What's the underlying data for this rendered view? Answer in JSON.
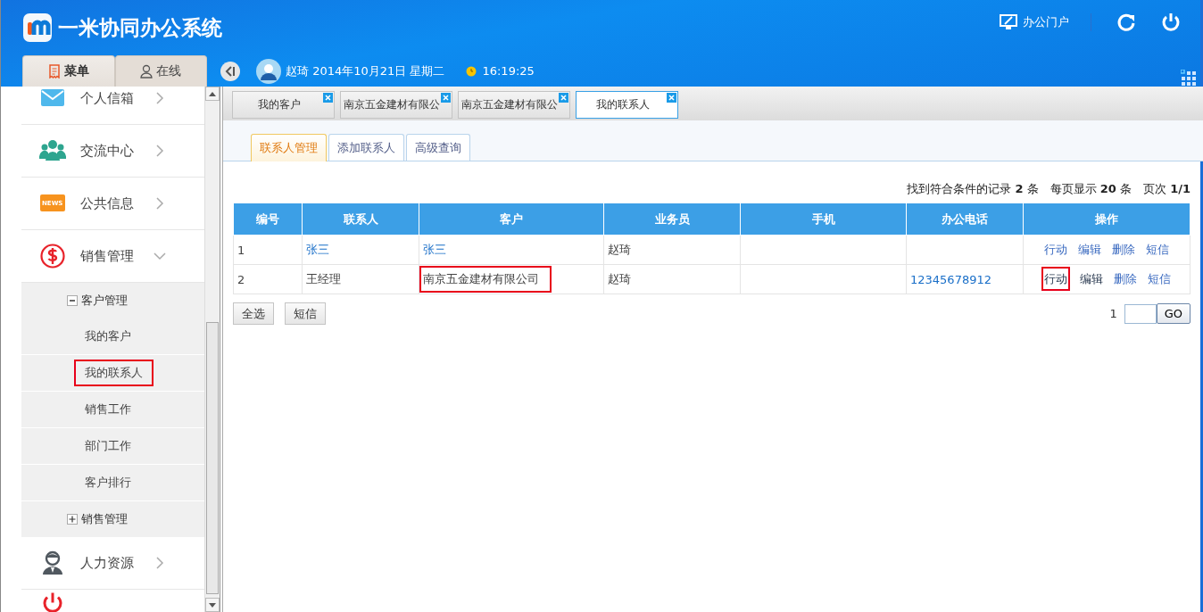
{
  "header": {
    "title": "一米协同办公系统",
    "portal_label": "办公门户"
  },
  "user_bar": {
    "user": "赵琦",
    "date": "2014年10月21日 星期二",
    "time": "16:19:25"
  },
  "sidebar": {
    "tabs": [
      {
        "label": "菜单",
        "kind": "receipt",
        "selected": true
      },
      {
        "label": "在线",
        "kind": "person",
        "selected": false
      }
    ],
    "items": [
      {
        "label": "个人信箱",
        "kind": "mail",
        "expanded": false
      },
      {
        "label": "交流中心",
        "kind": "people",
        "expanded": false
      },
      {
        "label": "公共信息",
        "kind": "news",
        "icon_text": "NEWS",
        "expanded": false
      },
      {
        "label": "销售管理",
        "kind": "dollar",
        "expanded": true,
        "children": [
          {
            "label": "客户管理",
            "expanded": true,
            "children": [
              {
                "label": "我的客户",
                "highlighted": false
              },
              {
                "label": "我的联系人",
                "highlighted": true
              },
              {
                "label": "销售工作",
                "highlighted": false
              },
              {
                "label": "部门工作",
                "highlighted": false
              },
              {
                "label": "客户排行",
                "highlighted": false
              }
            ]
          },
          {
            "label": "销售管理",
            "expanded": false
          }
        ]
      },
      {
        "label": "人力资源",
        "kind": "worker",
        "expanded": false
      },
      {
        "kind": "power"
      }
    ]
  },
  "page_tabs": [
    {
      "label": "我的客户",
      "selected": false
    },
    {
      "label": "南京五金建材有限公",
      "selected": false
    },
    {
      "label": "南京五金建材有限公",
      "selected": false
    },
    {
      "label": "我的联系人",
      "selected": true
    }
  ],
  "sub_tabs": [
    {
      "label": "联系人管理",
      "selected": true
    },
    {
      "label": "添加联系人",
      "selected": false
    },
    {
      "label": "高级查询",
      "selected": false
    }
  ],
  "summary": "找到符合条件的记录 **2** 条　每页显示 **20** 条　页次 **1/1**",
  "table": {
    "columns": [
      "编号",
      "联系人",
      "客户",
      "业务员",
      "手机",
      "办公电话",
      "操作"
    ],
    "rows": [
      {
        "cells": [
          {
            "text": "1",
            "kind": "text",
            "highlighted": false
          },
          {
            "text": "张三",
            "kind": "link",
            "highlighted": false
          },
          {
            "text": "张三",
            "kind": "link",
            "highlighted": false
          },
          {
            "text": "赵琦",
            "kind": "text",
            "highlighted": false
          },
          {},
          {}
        ],
        "actions": [
          {
            "label": "行动",
            "visited": false,
            "highlighted": false
          },
          {
            "label": "编辑",
            "visited": false,
            "highlighted": false
          },
          {
            "label": "删除",
            "visited": false,
            "highlighted": false
          },
          {
            "label": "短信",
            "visited": false,
            "highlighted": false
          }
        ]
      },
      {
        "cells": [
          {
            "text": "2",
            "kind": "text",
            "highlighted": false
          },
          {
            "text": "王经理",
            "kind": "text",
            "highlighted": false
          },
          {
            "text": "南京五金建材有限公司",
            "kind": "text",
            "highlighted": true
          },
          {
            "text": "赵琦",
            "kind": "text",
            "highlighted": false
          },
          {},
          {
            "text": "12345678912",
            "kind": "link",
            "highlighted": false
          }
        ],
        "actions": [
          {
            "label": "行动",
            "visited": true,
            "highlighted": true
          },
          {
            "label": "编辑",
            "visited": true,
            "highlighted": false
          },
          {
            "label": "删除",
            "visited": false,
            "highlighted": false
          },
          {
            "label": "短信",
            "visited": false,
            "highlighted": false
          }
        ]
      }
    ]
  },
  "buttons": [
    "全选",
    "短信"
  ],
  "pager": {
    "page": "1",
    "go": "GO"
  }
}
